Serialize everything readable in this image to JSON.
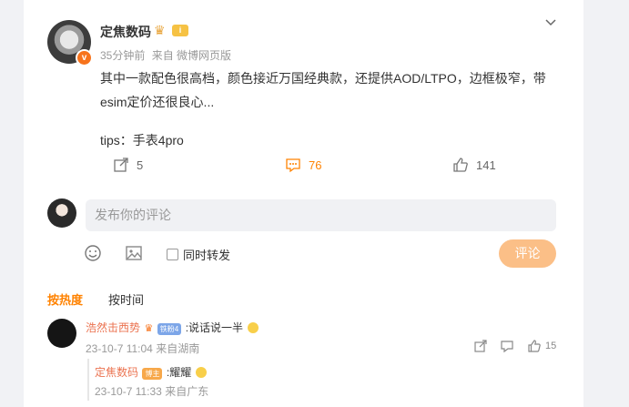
{
  "post": {
    "author": "定焦数码",
    "level_badge": "i",
    "time": "35分钟前",
    "source": "来自 微博网页版",
    "text_line1": "其中一款配色很高档，颜色接近万国经典款，还提供AOD/LTPO，边框极窄，带",
    "text_line2": "esim定价还很良心...",
    "text_line3": "tips：手表4pro",
    "repost_count": "5",
    "comment_count": "76",
    "like_count": "141",
    "vip_badge": "v"
  },
  "composer": {
    "placeholder": "发布你的评论",
    "repost_label": "同时转发",
    "submit_label": "评论"
  },
  "sort": {
    "hot": "按热度",
    "time": "按时间"
  },
  "comments": [
    {
      "user": "浩然击西势",
      "badge": "铁粉4",
      "text": ":说话说一半",
      "time": "23-10-7 11:04",
      "location": "来自湖南",
      "likes": "15"
    }
  ],
  "reply": {
    "user": "定焦数码",
    "badge": "博主",
    "text": ":耀耀",
    "time": "23-10-7 11:33",
    "location": "来自广东"
  },
  "colors": {
    "accent": "#ff8200",
    "button": "#fbbf87",
    "name_link": "#eb7350"
  }
}
